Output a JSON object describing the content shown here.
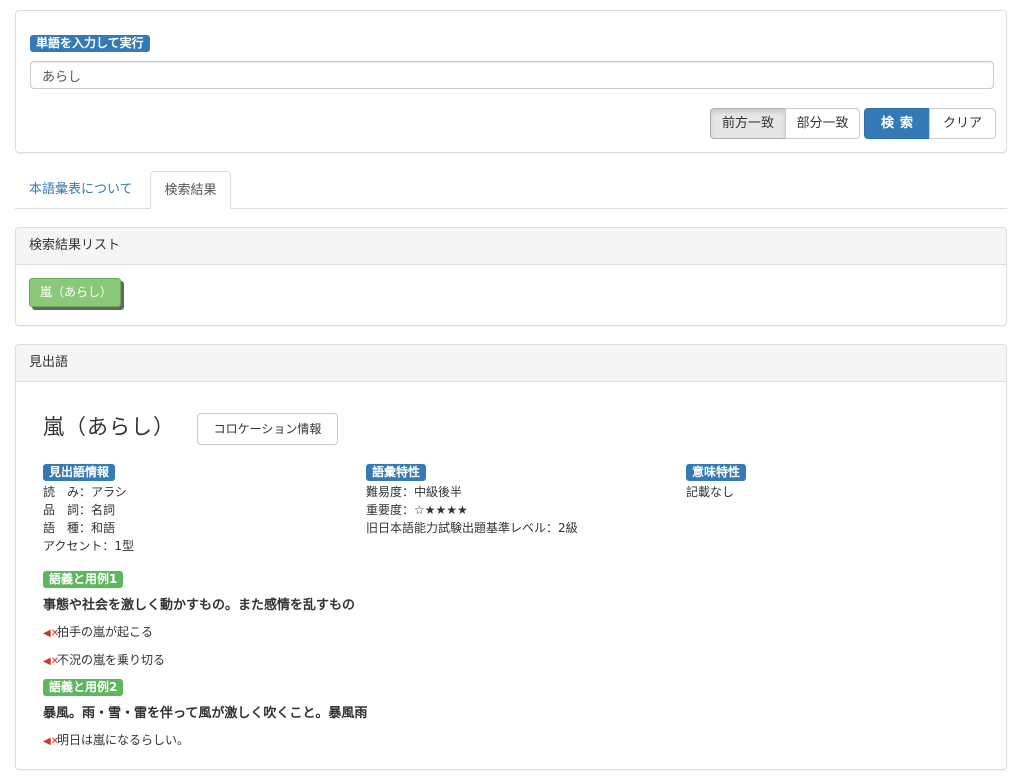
{
  "search": {
    "label": "単語を入力して実行",
    "value": "あらし",
    "buttons": {
      "prefix": "前方一致",
      "partial": "部分一致",
      "search": "検索",
      "clear": "クリア"
    }
  },
  "tabs": {
    "about": "本語彙表について",
    "results": "検索結果"
  },
  "results": {
    "heading": "検索結果リスト",
    "items": [
      "嵐（あらし）"
    ]
  },
  "entry": {
    "heading": "見出語",
    "headword": "嵐（あらし）",
    "collocation_button": "コロケーション情報",
    "headword_info": {
      "label": "見出語情報",
      "lines": [
        "読　み：アラシ",
        "品　詞：名詞",
        "語　種：和語",
        "アクセント：1型"
      ]
    },
    "vocab_info": {
      "label": "語彙特性",
      "lines": [
        "難易度：中級後半",
        "重要度：☆★★★★",
        "旧日本語能力試験出題基準レベル：2級"
      ]
    },
    "meaning_info": {
      "label": "意味特性",
      "lines": [
        "記載なし"
      ]
    },
    "senses": [
      {
        "label": "語義と用例1",
        "definition": "事態や社会を激しく動かすもの。また感情を乱すもの",
        "examples": [
          "拍手の嵐が起こる",
          "不況の嵐を乗り切る"
        ]
      },
      {
        "label": "語義と用例2",
        "definition": "暴風。雨・雪・雷を伴って風が激しく吹くこと。暴風雨",
        "examples": [
          "明日は嵐になるらしい。"
        ]
      }
    ],
    "speaker_icon": "speaker-mute-icon"
  }
}
